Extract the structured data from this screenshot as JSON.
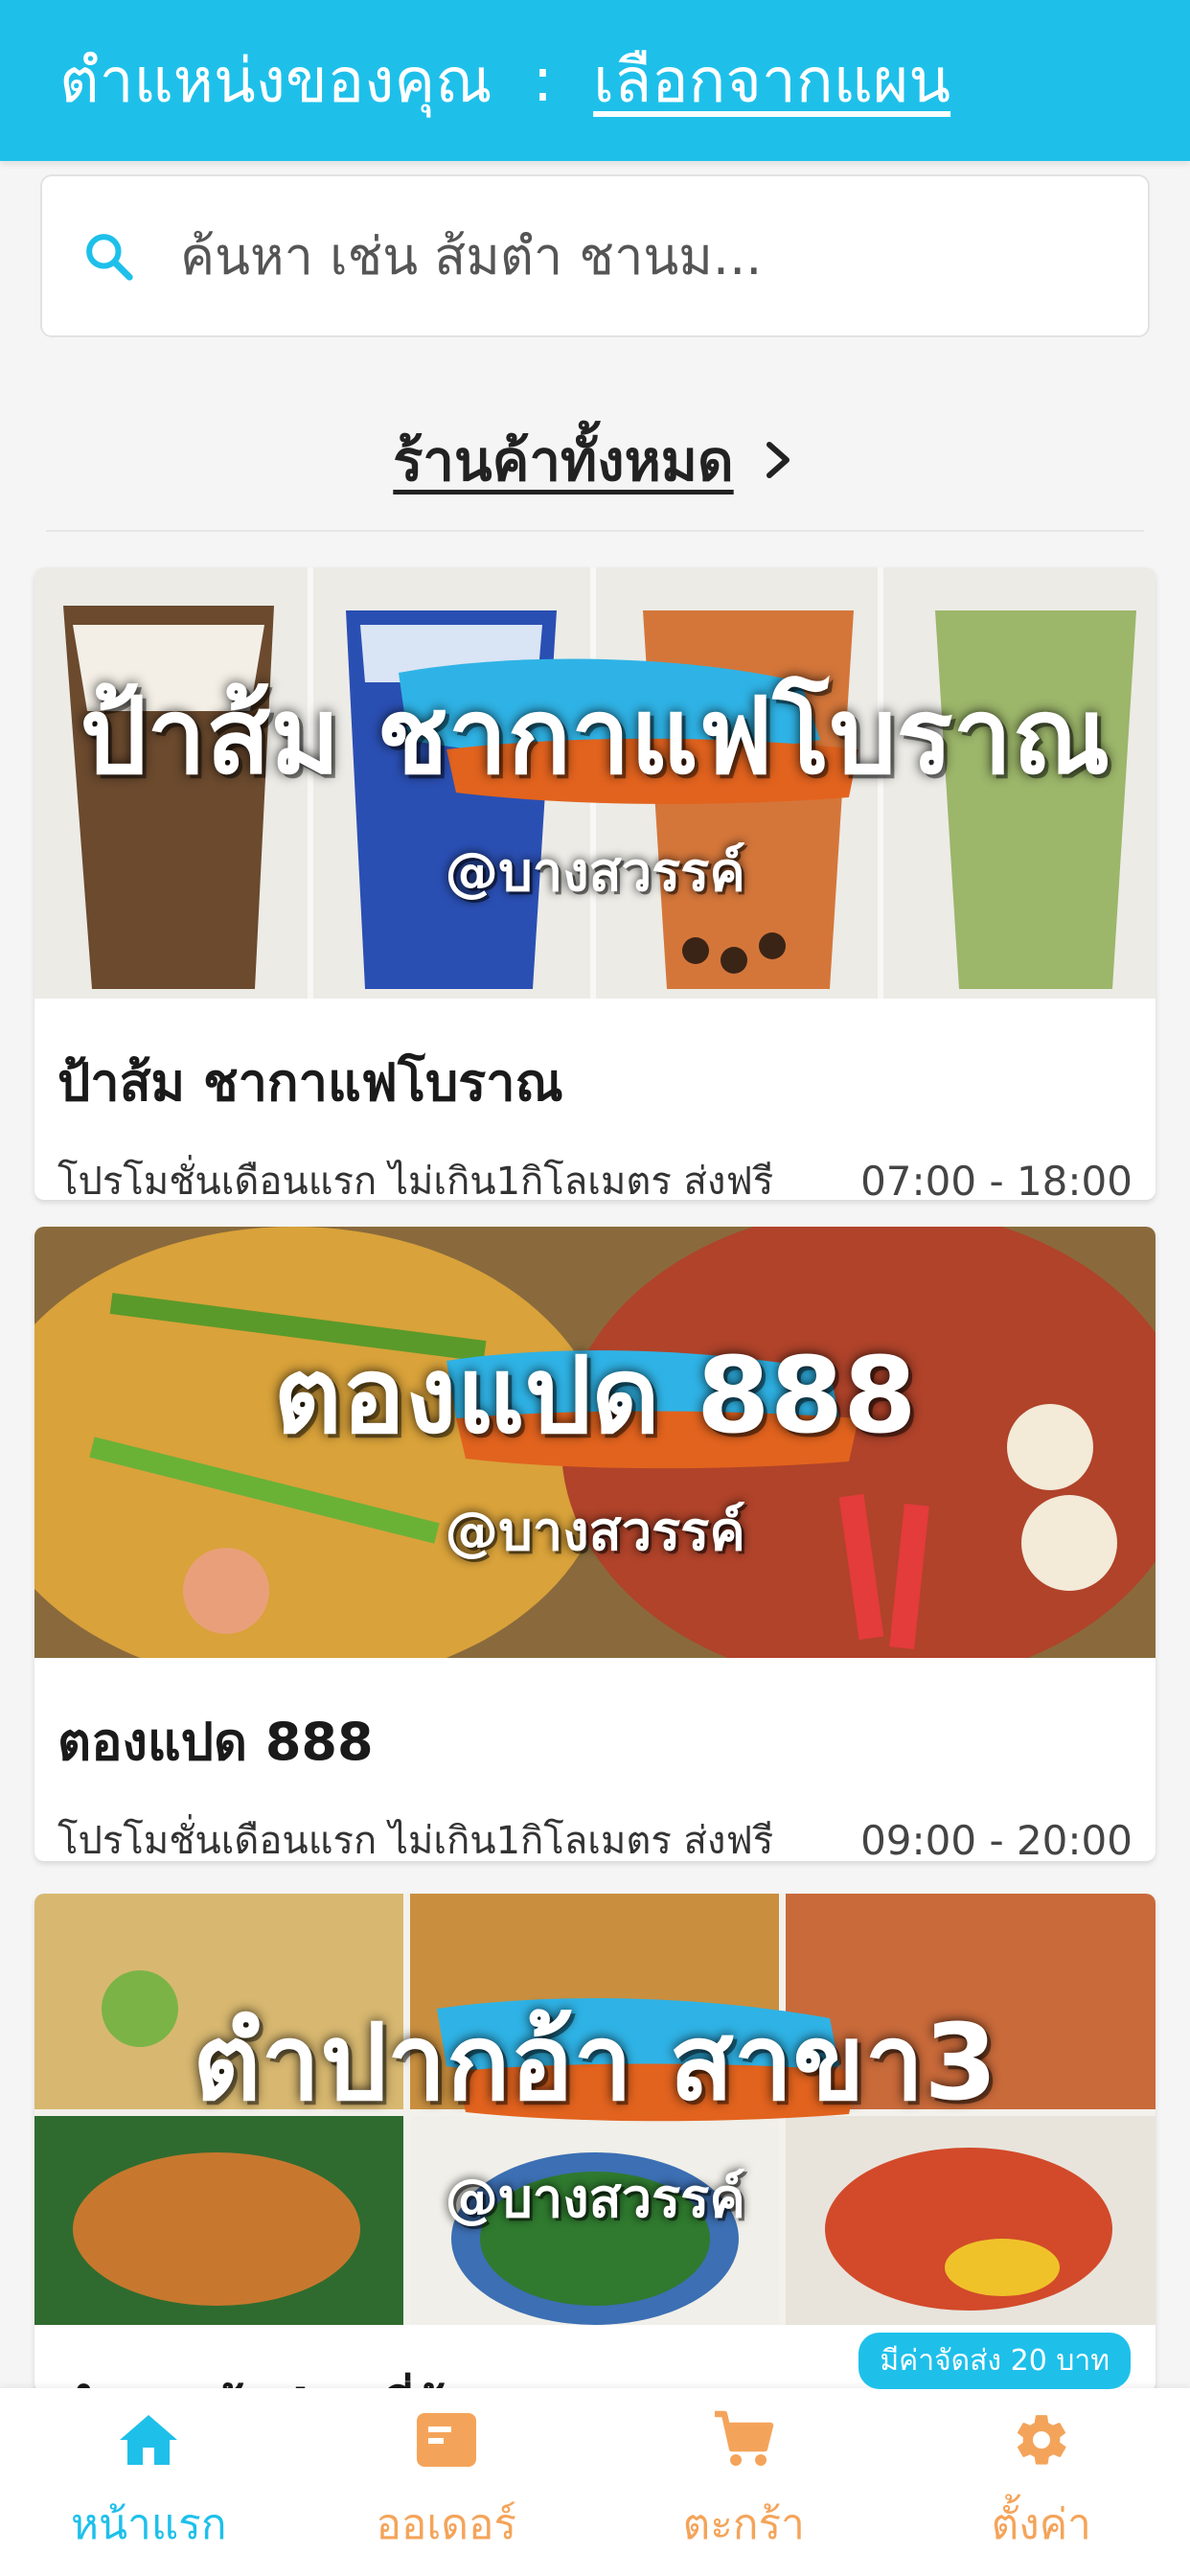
{
  "header": {
    "location_label": "ตำแหน่งของคุณ",
    "separator": ":",
    "choose_map_link": "เลือกจากแผน"
  },
  "search": {
    "placeholder": "ค้นหา เช่น ส้มตำ ชานม..."
  },
  "all_shops": {
    "label": "ร้านค้าทั้งหมด"
  },
  "shops": [
    {
      "banner_title": "ป้าส้ม ชากาแฟโบราณ",
      "banner_branch": "@บางสวรรค์",
      "name": "ป้าส้ม ชากาแฟโบราณ",
      "promo": "โปรโมชั่นเดือนแรก ไม่เกิน1กิโลเมตร ส่งฟรี",
      "hours": "07:00 - 18:00"
    },
    {
      "banner_title": "ตองแปด 888",
      "banner_branch": "@บางสวรรค์",
      "name": "ตองแปด 888",
      "promo": "โปรโมชั่นเดือนแรก ไม่เกิน1กิโลเมตร ส่งฟรี",
      "hours": "09:00 - 20:00"
    },
    {
      "banner_title": "ตำปากอ้า สาขา3",
      "banner_branch": "@บางสวรรค์",
      "name": "ตำปากอ้า by พี่อ้วย",
      "fee_badge": "มีค่าจัดส่ง 20 บาท"
    }
  ],
  "nav": {
    "items": [
      {
        "label": "หน้าแรก",
        "icon": "home-icon",
        "active": true
      },
      {
        "label": "ออเดอร์",
        "icon": "order-icon",
        "active": false
      },
      {
        "label": "ตะกร้า",
        "icon": "cart-icon",
        "active": false
      },
      {
        "label": "ตั้งค่า",
        "icon": "gear-icon",
        "active": false
      }
    ]
  },
  "colors": {
    "brand": "#1ec0ea",
    "nav_inactive": "#f4a45a",
    "text": "#222222"
  }
}
